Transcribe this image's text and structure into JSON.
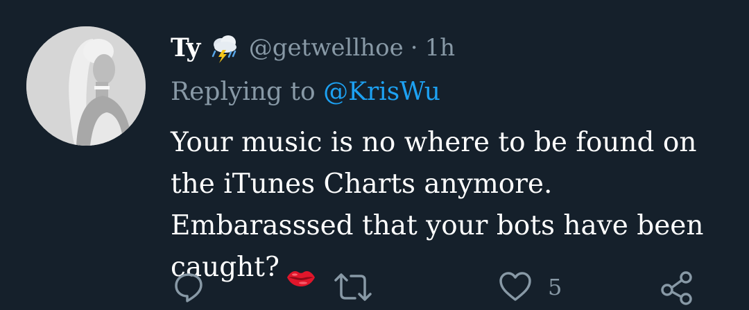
{
  "tweet": {
    "display_name": "Ty",
    "name_emoji": "cloud-with-lightning-and-rain-emoji",
    "handle": "@getwellhoe",
    "separator": "·",
    "timestamp": "1h",
    "replying_prefix": "Replying to",
    "replying_to": "@KrisWu",
    "text_main": "Your music is no where to be found on the iTunes Charts anymore. Embarasssed that your bots have been caught?",
    "text_emoji": "kiss-mark-emoji"
  },
  "actions": {
    "reply_icon": "reply-icon",
    "retweet_icon": "retweet-icon",
    "like_icon": "heart-icon",
    "like_count": "5",
    "share_icon": "share-icon"
  },
  "colors": {
    "background": "#15202b",
    "text_primary": "#ffffff",
    "text_secondary": "#8899a6",
    "link": "#1da1f2",
    "lips": "#e0162b"
  }
}
